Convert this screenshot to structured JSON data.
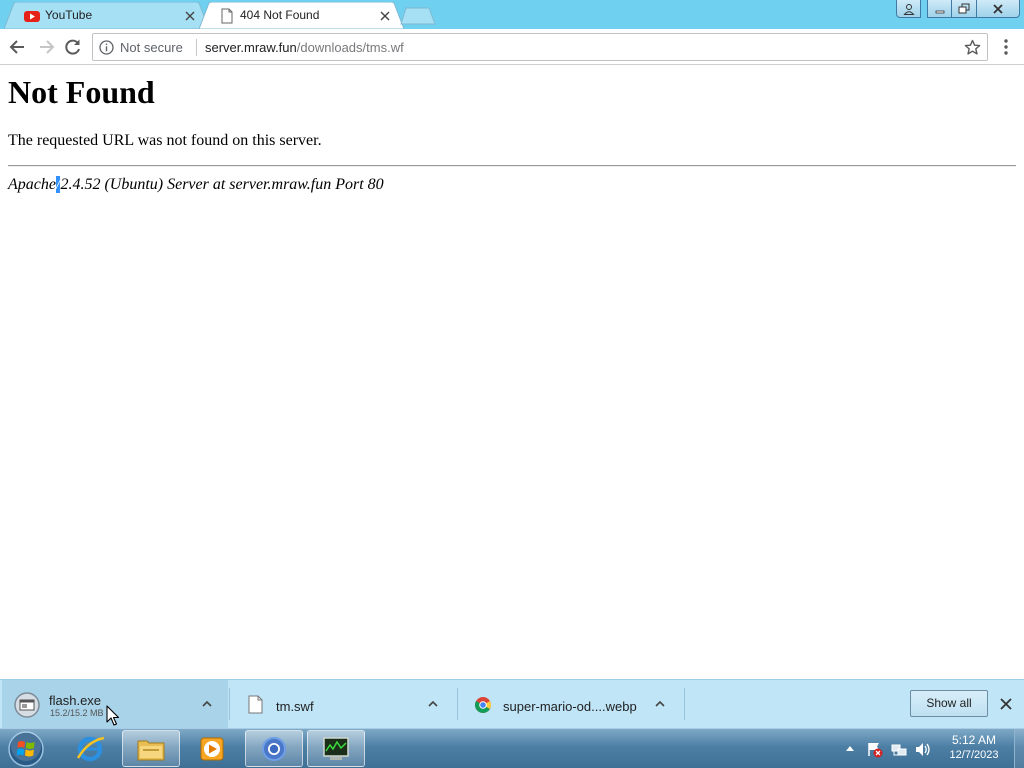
{
  "browser": {
    "tabs": [
      {
        "title": "YouTube",
        "icon": "youtube-icon",
        "active": false
      },
      {
        "title": "404 Not Found",
        "icon": "document-icon",
        "active": true
      }
    ],
    "omnibox": {
      "security_label": "Not secure",
      "url_host": "server.mraw.fun",
      "url_path": "/downloads/tms.wf"
    }
  },
  "page": {
    "heading": "Not Found",
    "message": "The requested URL was not found on this server.",
    "signature": {
      "before": "Apache",
      "selected": "/",
      "after": "2.4.52 (Ubuntu) Server at server.mraw.fun Port 80"
    }
  },
  "downloads": {
    "items": [
      {
        "name": "flash.exe",
        "status": "15.2/15.2 MB",
        "icon": "exe-file-icon"
      },
      {
        "name": "tm.swf",
        "status": "",
        "icon": "blank-file-icon"
      },
      {
        "name": "super-mario-od....webp",
        "status": "",
        "icon": "chrome-file-icon"
      }
    ],
    "show_all_label": "Show all"
  },
  "taskbar": {
    "apps": [
      "internet-explorer-icon",
      "windows-explorer-icon",
      "media-player-icon",
      "chrome-icon",
      "task-manager-icon"
    ],
    "clock": {
      "time": "5:12 AM",
      "date": "12/7/2023"
    }
  },
  "colors": {
    "titlebar": "#6fd0ef",
    "shelf": "#bfe5f7",
    "selection": "#3390ff"
  }
}
